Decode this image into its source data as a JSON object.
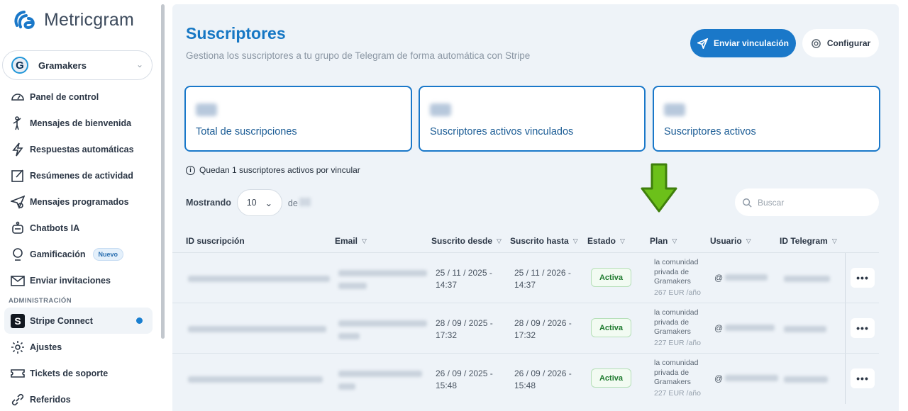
{
  "sidebar": {
    "brand": "Metricgram",
    "workspace": {
      "name": "Gramakers",
      "initial": "G"
    },
    "items": [
      {
        "name": "nav-panel-control",
        "label": "Panel de control",
        "icon": "gauge-icon"
      },
      {
        "name": "nav-mensajes-bienvenida",
        "label": "Mensajes de bienvenida",
        "icon": "waving-person-icon"
      },
      {
        "name": "nav-respuestas-automaticas",
        "label": "Respuestas automáticas",
        "icon": "lightning-icon"
      },
      {
        "name": "nav-resumenes-actividad",
        "label": "Resúmenes de actividad",
        "icon": "edit-square-icon"
      },
      {
        "name": "nav-mensajes-programados",
        "label": "Mensajes programados",
        "icon": "scheduled-send-icon"
      },
      {
        "name": "nav-chatbots-ia",
        "label": "Chatbots IA",
        "icon": "robot-icon"
      },
      {
        "name": "nav-gamificacion",
        "label": "Gamificación",
        "icon": "medal-icon",
        "badge": "Nuevo"
      },
      {
        "name": "nav-enviar-invitaciones",
        "label": "Enviar invitaciones",
        "icon": "envelope-icon"
      }
    ],
    "admin_label": "ADMINISTRACIÓN",
    "admin_items": [
      {
        "name": "nav-stripe-connect",
        "label": "Stripe Connect",
        "icon": "stripe-icon",
        "active": true
      },
      {
        "name": "nav-ajustes",
        "label": "Ajustes",
        "icon": "gear-icon"
      },
      {
        "name": "nav-tickets-soporte",
        "label": "Tickets de soporte",
        "icon": "ticket-icon"
      },
      {
        "name": "nav-referidos",
        "label": "Referidos",
        "icon": "link-icon"
      }
    ]
  },
  "header": {
    "title": "Suscriptores",
    "subtitle": "Gestiona los suscriptores a tu grupo de Telegram de forma automática con Stripe",
    "send_label": "Enviar vinculación",
    "config_label": "Configurar"
  },
  "stats": [
    {
      "label": "Total de suscripciones"
    },
    {
      "label": "Suscriptores activos vinculados"
    },
    {
      "label": "Suscriptores activos"
    }
  ],
  "notice": "Quedan 1 suscriptores activos por vincular",
  "table_controls": {
    "showing_label": "Mostrando",
    "page_size": "10",
    "of_label": "de",
    "search_placeholder": "Buscar"
  },
  "table": {
    "columns": [
      "ID suscripción",
      "Email",
      "Suscrito desde",
      "Suscrito hasta",
      "Estado",
      "Plan",
      "Usuario",
      "ID Telegram"
    ],
    "rows": [
      {
        "from": "25 / 11 / 2025 -",
        "from_time": "14:37",
        "to": "25 / 11 / 2026 -",
        "to_time": "14:37",
        "status": "Activa",
        "plan_lines": [
          "la comunidad",
          "privada de",
          "Gramakers"
        ],
        "price": "267 EUR /año",
        "user_prefix": "@"
      },
      {
        "from": "28 / 09 / 2025 -",
        "from_time": "17:32",
        "to": "28 / 09 / 2026 -",
        "to_time": "17:32",
        "status": "Activa",
        "plan_lines": [
          "la comunidad",
          "privada de",
          "Gramakers"
        ],
        "price": "227 EUR /año",
        "user_prefix": "@"
      },
      {
        "from": "26 / 09 / 2025 -",
        "from_time": "15:48",
        "to": "26 / 09 / 2026 -",
        "to_time": "15:48",
        "status": "Activa",
        "plan_lines": [
          "la comunidad",
          "privada de",
          "Gramakers"
        ],
        "price": "227 EUR /año",
        "user_prefix": "@"
      }
    ],
    "more_label": "•••"
  },
  "colors": {
    "accent": "#1a78c9",
    "status_active": "#1e7a2e",
    "arrow": "#6cc01a"
  }
}
